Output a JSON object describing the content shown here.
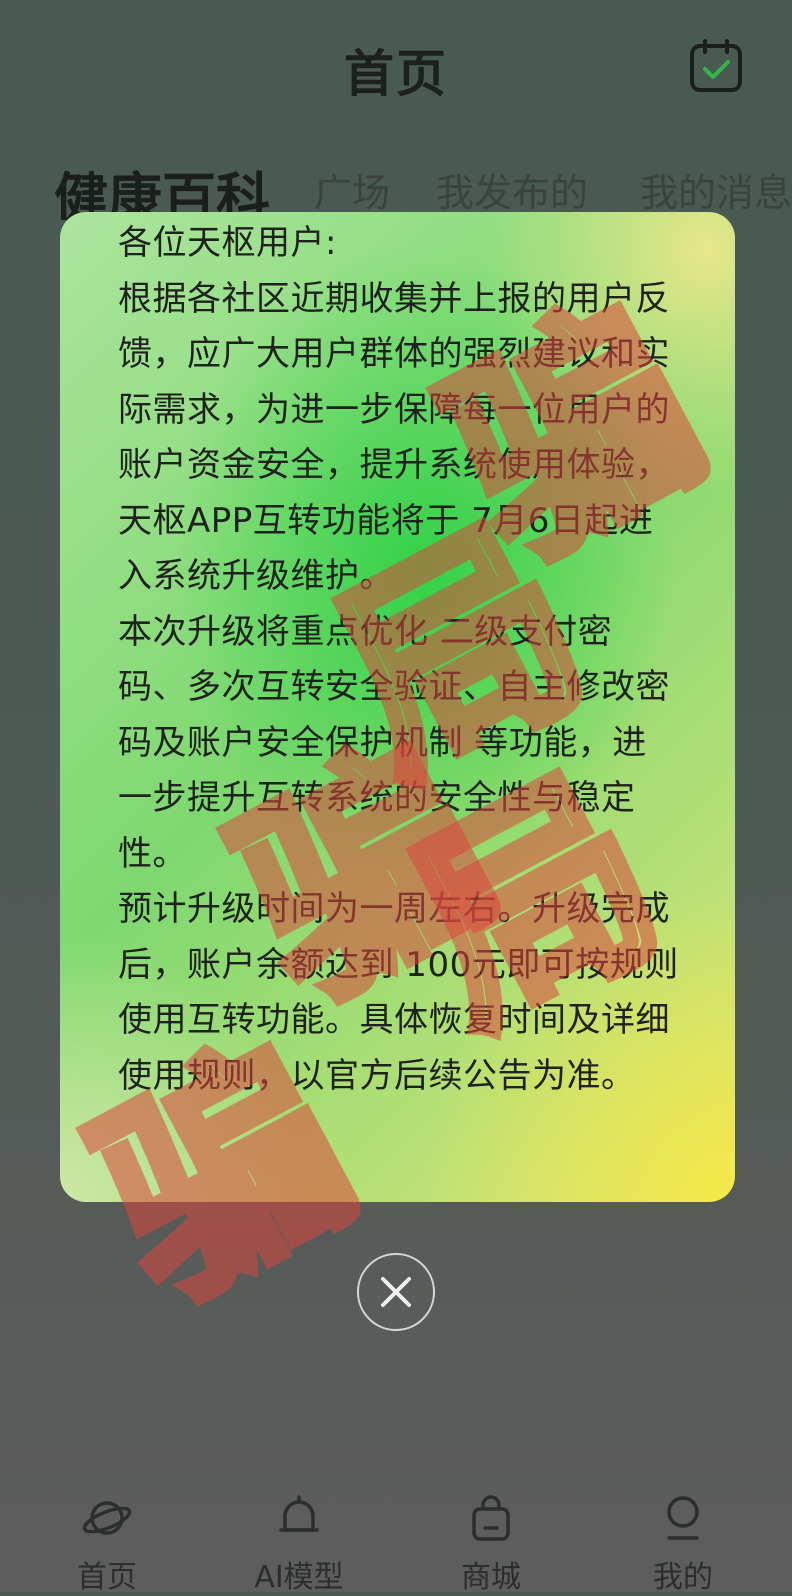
{
  "header": {
    "title": "首页",
    "calendar_icon": "calendar-check-icon"
  },
  "tabs": [
    {
      "label": "健康百科",
      "active": true
    },
    {
      "label": "广场"
    },
    {
      "label": "我发布的"
    },
    {
      "label": "我的消息"
    }
  ],
  "notice": {
    "text": "各位天枢用户:\n根据各社区近期收集并上报的用户反馈，应广大用户群体的强烈建议和实际需求，为进一步保障每一位用户的账户资金安全，提升系统使用体验，天枢APP互转功能将于 7月6日起进入系统升级维护。\n本次升级将重点优化 二级支付密码、多次互转安全验证、自主修改密码及账户安全保护机制 等功能，进一步提升互转系统的安全性与稳定性。\n预计升级时间为一周左右。升级完成后，账户余额达到 100元即可按规则使用互转功能。具体恢复时间及详细使用规则，以官方后续公告为准。",
    "close_icon": "close-icon"
  },
  "watermark": {
    "chars": [
      "骗",
      "局",
      "骗",
      "局",
      "骗"
    ],
    "color": "#da463c"
  },
  "bottom_nav": [
    {
      "label": "首页",
      "icon": "planet-icon"
    },
    {
      "label": "AI模型",
      "icon": "bell-icon"
    },
    {
      "label": "商城",
      "icon": "shopping-bag-icon"
    },
    {
      "label": "我的",
      "icon": "user-icon"
    }
  ]
}
